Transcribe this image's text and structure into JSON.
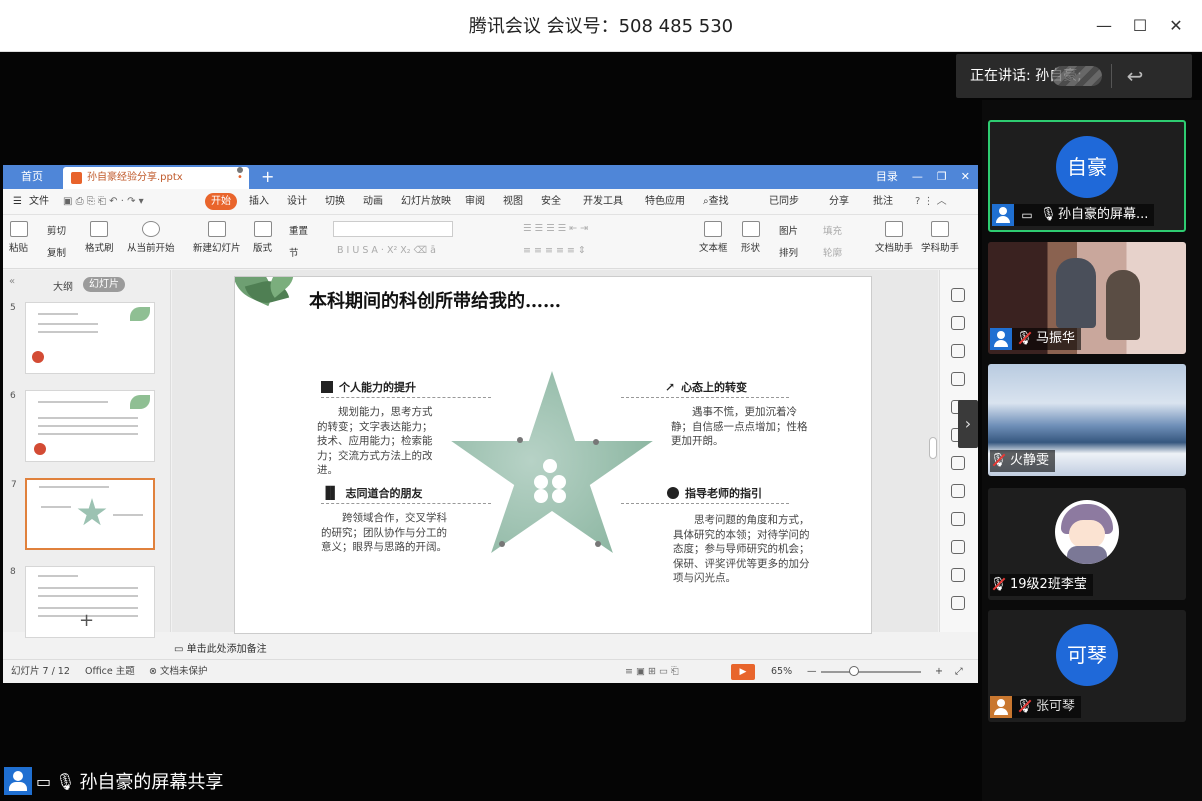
{
  "window": {
    "title": "腾讯会议 会议号：508 485 530",
    "minimize": "—",
    "maximize": "☐",
    "close": "✕"
  },
  "speaking": {
    "label": "正在讲话: 孙自豪;",
    "back_icon": "reply-icon"
  },
  "participants": [
    {
      "avatar_text": "自豪",
      "name": "孙自豪的屏幕...",
      "sharing": true,
      "muted": false,
      "video": "avatar"
    },
    {
      "name": "马振华",
      "muted": true,
      "video": "camera"
    },
    {
      "name": "火静雯",
      "muted": true,
      "video": "landscape"
    },
    {
      "name": "19级2班李莹",
      "muted": true,
      "video": "cartoon"
    },
    {
      "avatar_text": "可琴",
      "name": "张可琴",
      "muted": true,
      "video": "avatar"
    }
  ],
  "share_label": "孙自豪的屏幕共享",
  "wps": {
    "tab_home": "首页",
    "tab_doc": "孙自豪经验分享.pptx",
    "tab_right": [
      "目录"
    ],
    "menu": [
      "文件",
      "开始",
      "插入",
      "设计",
      "切换",
      "动画",
      "幻灯片放映",
      "审阅",
      "视图",
      "安全",
      "开发工具",
      "特色应用",
      "查找",
      "已同步",
      "分享",
      "批注"
    ],
    "ribbon": {
      "paste": "粘贴",
      "cut": "剪切",
      "copy": "复制",
      "format_painter": "格式刷",
      "from_current": "从当前开始",
      "new_slide": "新建幻灯片",
      "layout": "版式",
      "reset": "重置",
      "section": "节",
      "textbox": "文本框",
      "shape": "形状",
      "picture": "图片",
      "arrange": "排列",
      "fill": "填充",
      "outline": "轮廓",
      "doc_assistant": "文档助手",
      "study_assistant": "学科助手"
    },
    "left_tabs": {
      "outline": "大纲",
      "slides": "幻灯片"
    },
    "thumb_numbers": [
      "5",
      "6",
      "7",
      "8"
    ],
    "notes_placeholder": "单击此处添加备注",
    "status": {
      "slide_info": "幻灯片 7 / 12",
      "theme": "Office 主题",
      "protect": "文档未保护",
      "zoom": "65%"
    }
  },
  "slide": {
    "title": "本科期间的科创所带给我的……",
    "sections": [
      {
        "title": "个人能力的提升",
        "body": "规划能力，思考方式的转变；文字表达能力；技术、应用能力；检索能力；交流方式方法上的改进。"
      },
      {
        "title": "心态上的转变",
        "body": "遇事不慌，更加沉着冷静；自信感一点点增加；性格更加开朗。"
      },
      {
        "title": "志同道合的朋友",
        "body": "跨领域合作，交叉学科的研究；团队协作与分工的意义；眼界与思路的开阔。"
      },
      {
        "title": "指导老师的指引",
        "body": "思考问题的角度和方式，具体研究的本领；对待学问的态度；参与导师研究的机会；保研、评奖评优等更多的加分项与闪光点。"
      }
    ]
  }
}
